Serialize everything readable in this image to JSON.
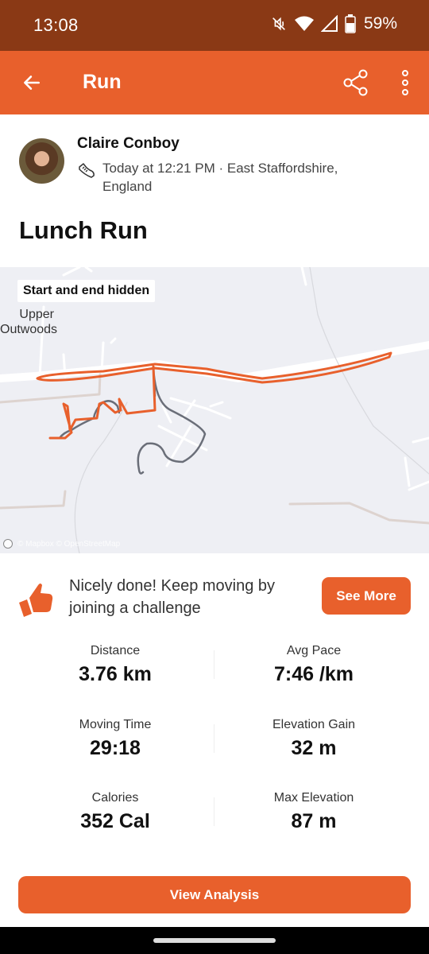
{
  "status_bar": {
    "time": "13:08",
    "battery": "59%",
    "icons": [
      "mute-icon",
      "wifi-icon",
      "signal-icon",
      "battery-icon"
    ]
  },
  "app_bar": {
    "title": "Run",
    "back_icon": "arrow-left-icon",
    "share_icon": "share-icon",
    "more_icon": "more-vertical-icon"
  },
  "activity": {
    "athlete_name": "Claire Conboy",
    "sport_icon": "running-shoe-icon",
    "meta": "Today at 12:21 PM · East Staffordshire, England",
    "title": "Lunch Run"
  },
  "map": {
    "badge": "Start and end hidden",
    "place_label": "Upper Outwoods",
    "attribution": "© Mapbox © OpenStreetMap",
    "route_color": "#e8602c",
    "hidden_route_color": "#6a6e78"
  },
  "promo": {
    "icon": "thumbs-up-icon",
    "text": "Nicely done! Keep moving by joining a challenge",
    "button": "See More"
  },
  "stats": [
    {
      "label": "Distance",
      "value": "3.76 km"
    },
    {
      "label": "Avg Pace",
      "value": "7:46 /km"
    },
    {
      "label": "Moving Time",
      "value": "29:18"
    },
    {
      "label": "Elevation Gain",
      "value": "32 m"
    },
    {
      "label": "Calories",
      "value": "352 Cal"
    },
    {
      "label": "Max Elevation",
      "value": "87 m"
    }
  ],
  "actions": {
    "view_analysis": "View Analysis"
  },
  "colors": {
    "brand": "#e8602c",
    "status_bar": "#8a3915"
  }
}
